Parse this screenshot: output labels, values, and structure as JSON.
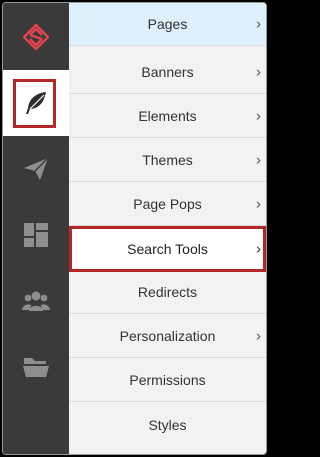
{
  "rail": {
    "items": [
      {
        "icon": "brand-logo-icon",
        "active": false
      },
      {
        "icon": "feather-icon",
        "active": true
      },
      {
        "icon": "paper-plane-icon",
        "active": false
      },
      {
        "icon": "dashboard-layout-icon",
        "active": false
      },
      {
        "icon": "users-group-icon",
        "active": false
      },
      {
        "icon": "folder-icon",
        "active": false
      }
    ]
  },
  "menu": {
    "items": [
      {
        "label": "Pages",
        "chevron": "›"
      },
      {
        "label": "Banners",
        "chevron": "›"
      },
      {
        "label": "Elements",
        "chevron": "›"
      },
      {
        "label": "Themes",
        "chevron": "›"
      },
      {
        "label": "Page Pops",
        "chevron": "›"
      },
      {
        "label": "Search Tools",
        "chevron": "›"
      },
      {
        "label": "Redirects",
        "chevron": ""
      },
      {
        "label": "Personalization",
        "chevron": "›"
      },
      {
        "label": "Permissions",
        "chevron": ""
      },
      {
        "label": "Styles",
        "chevron": ""
      }
    ],
    "hovered_index": 0,
    "selected_index": 5
  },
  "colors": {
    "rail_bg": "#3a3a3a",
    "icon_gray": "#8e8e8e",
    "brand_red": "#e2434f",
    "highlight_red": "#b3262a",
    "menu_bg": "#f2f2f2",
    "hover_bg": "#ddf0fb"
  }
}
